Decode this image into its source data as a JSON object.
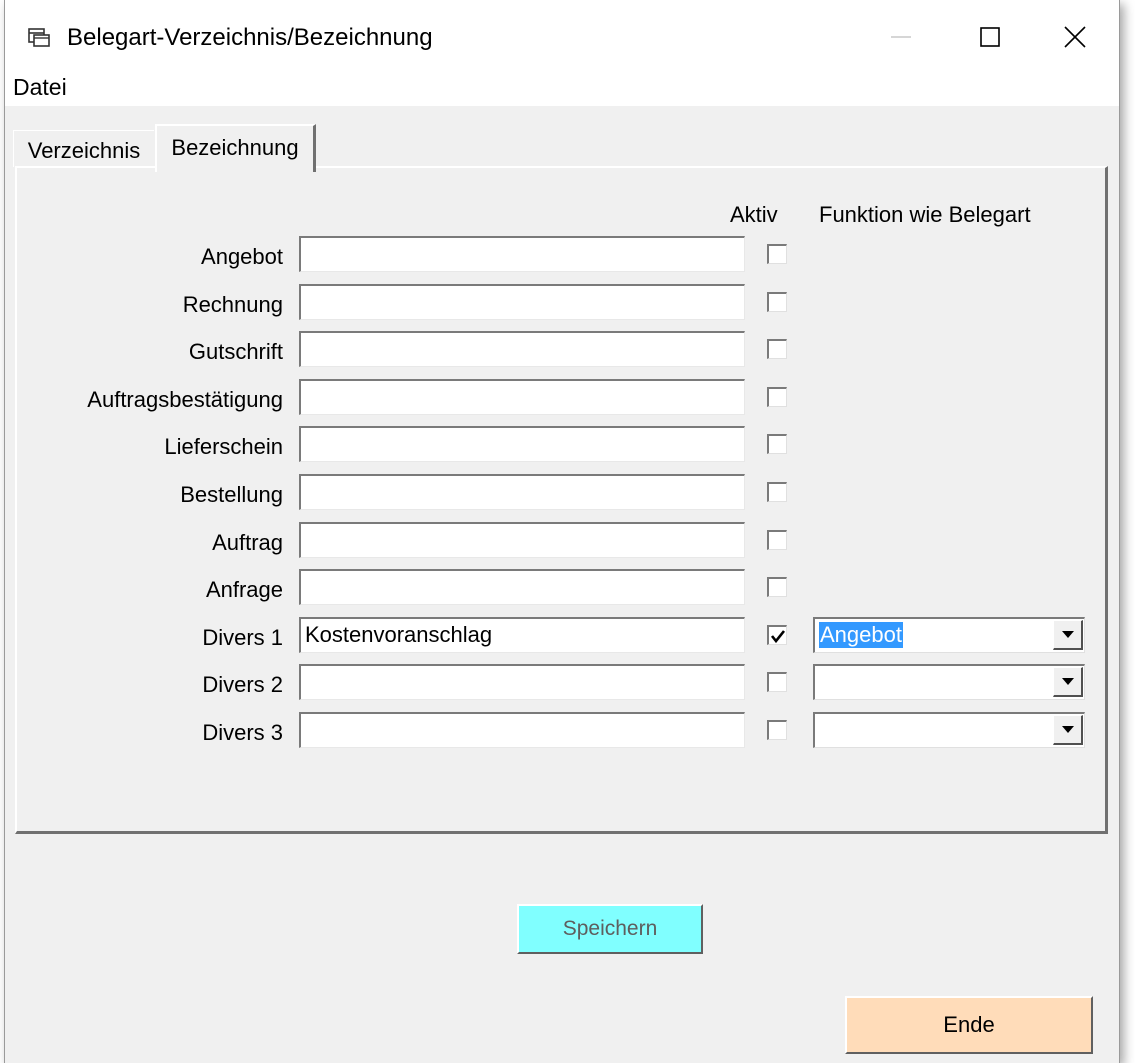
{
  "window": {
    "title": "Belegart-Verzeichnis/Bezeichnung",
    "icon": "form-window-icon",
    "controls": [
      "minimize-icon",
      "maximize-icon",
      "close-icon"
    ]
  },
  "menu": {
    "items": [
      "Datei"
    ]
  },
  "tabs": [
    {
      "label": "Verzeichnis",
      "active": false
    },
    {
      "label": "Bezeichnung",
      "active": true
    }
  ],
  "columns": {
    "aktiv": "Aktiv",
    "funktion": "Funktion wie Belegart"
  },
  "rows": [
    {
      "label": "Angebot",
      "value": "",
      "checked": false
    },
    {
      "label": "Rechnung",
      "value": "",
      "checked": false
    },
    {
      "label": "Gutschrift",
      "value": "",
      "checked": false
    },
    {
      "label": "Auftragsbestätigung",
      "value": "",
      "checked": false
    },
    {
      "label": "Lieferschein",
      "value": "",
      "checked": false
    },
    {
      "label": "Bestellung",
      "value": "",
      "checked": false
    },
    {
      "label": "Auftrag",
      "value": "",
      "checked": false
    },
    {
      "label": "Anfrage",
      "value": "",
      "checked": false
    },
    {
      "label": "Divers 1",
      "value": "Kostenvoranschlag",
      "checked": true,
      "funktion": "Angebot"
    },
    {
      "label": "Divers 2",
      "value": "",
      "checked": false,
      "funktion": ""
    },
    {
      "label": "Divers 3",
      "value": "",
      "checked": false,
      "funktion": ""
    }
  ],
  "buttons": {
    "save": "Speichern",
    "end": "Ende"
  },
  "colors": {
    "save_button": "#80ffff",
    "end_button": "#ffdcb9",
    "selection": "#3399ff"
  }
}
